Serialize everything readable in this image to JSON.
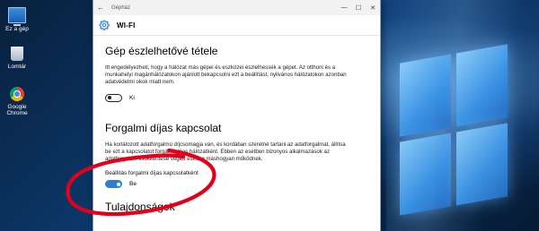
{
  "desktop": {
    "icons": [
      {
        "label": "Ez a gép",
        "icon": "computer-icon"
      },
      {
        "label": "Lomtár",
        "icon": "recycle-bin-icon"
      },
      {
        "label": "Google Chrome",
        "icon": "chrome-icon"
      }
    ]
  },
  "window": {
    "title": "Gépház",
    "back_icon": "←",
    "minimize_icon": "—",
    "maximize_icon": "☐",
    "close_icon": "✕",
    "header": {
      "icon": "gear-icon",
      "title": "WI-FI"
    },
    "sections": {
      "discover": {
        "title": "Gép észlelhetővé tétele",
        "description": "Itt engedélyezheti, hogy a hálózat más gépei és eszközei észlelhessék a gépet. Az otthoni és a munkahelyi magánhálózatokon ajánlott bekapcsolni ezt a beállítást, nyilvános hálózatokon azonban adatvédelmi okok miatt nem.",
        "toggle_state": "Ki",
        "toggle_on": false
      },
      "metered": {
        "title": "Forgalmi díjas kapcsolat",
        "description": "Ha korlátozott adatforgalmú díjcsomagja van, és kordában szeretné tartani az adatforgalmat, állítsa be ezt a kapcsolatot forgalmi díjas hálózatként. Ebben az esetben bizonyos alkalmazások az adatforgalom csökkentése végett esetleg máshogyan működnek.",
        "setting_label": "Beállítás forgalmi díjas kapcsolatként",
        "toggle_state": "Be",
        "toggle_on": true
      },
      "properties": {
        "title": "Tulajdonságok"
      }
    },
    "colors": {
      "accent": "#2b7fd6",
      "annotation": "#e0001b"
    }
  }
}
